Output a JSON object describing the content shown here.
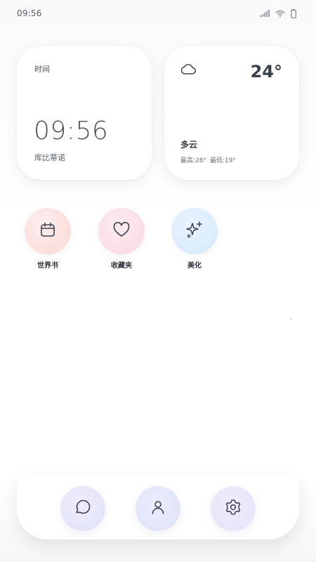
{
  "status_bar": {
    "time": "09:56",
    "icons": [
      "signal-icon",
      "wifi-icon",
      "battery-icon"
    ]
  },
  "time_widget": {
    "label": "时间",
    "clock": "09:56",
    "name": "库比蒂诺"
  },
  "weather_widget": {
    "icon": "cloud-icon",
    "temperature": "24°",
    "condition": "多云",
    "high": "最高:28°",
    "low": "最低:19°"
  },
  "apps": [
    {
      "label": "世界书",
      "icon": "calendar-icon"
    },
    {
      "label": "收藏夹",
      "icon": "heart-icon"
    },
    {
      "label": "美化",
      "icon": "sparkles-icon"
    }
  ],
  "dock": {
    "items": [
      {
        "icon": "chat-icon"
      },
      {
        "icon": "user-icon"
      },
      {
        "icon": "settings-icon"
      }
    ]
  },
  "colors": {
    "text_primary": "#3a404c",
    "icon_stroke": "#3d4250",
    "widget_bg": "#ffffff"
  }
}
